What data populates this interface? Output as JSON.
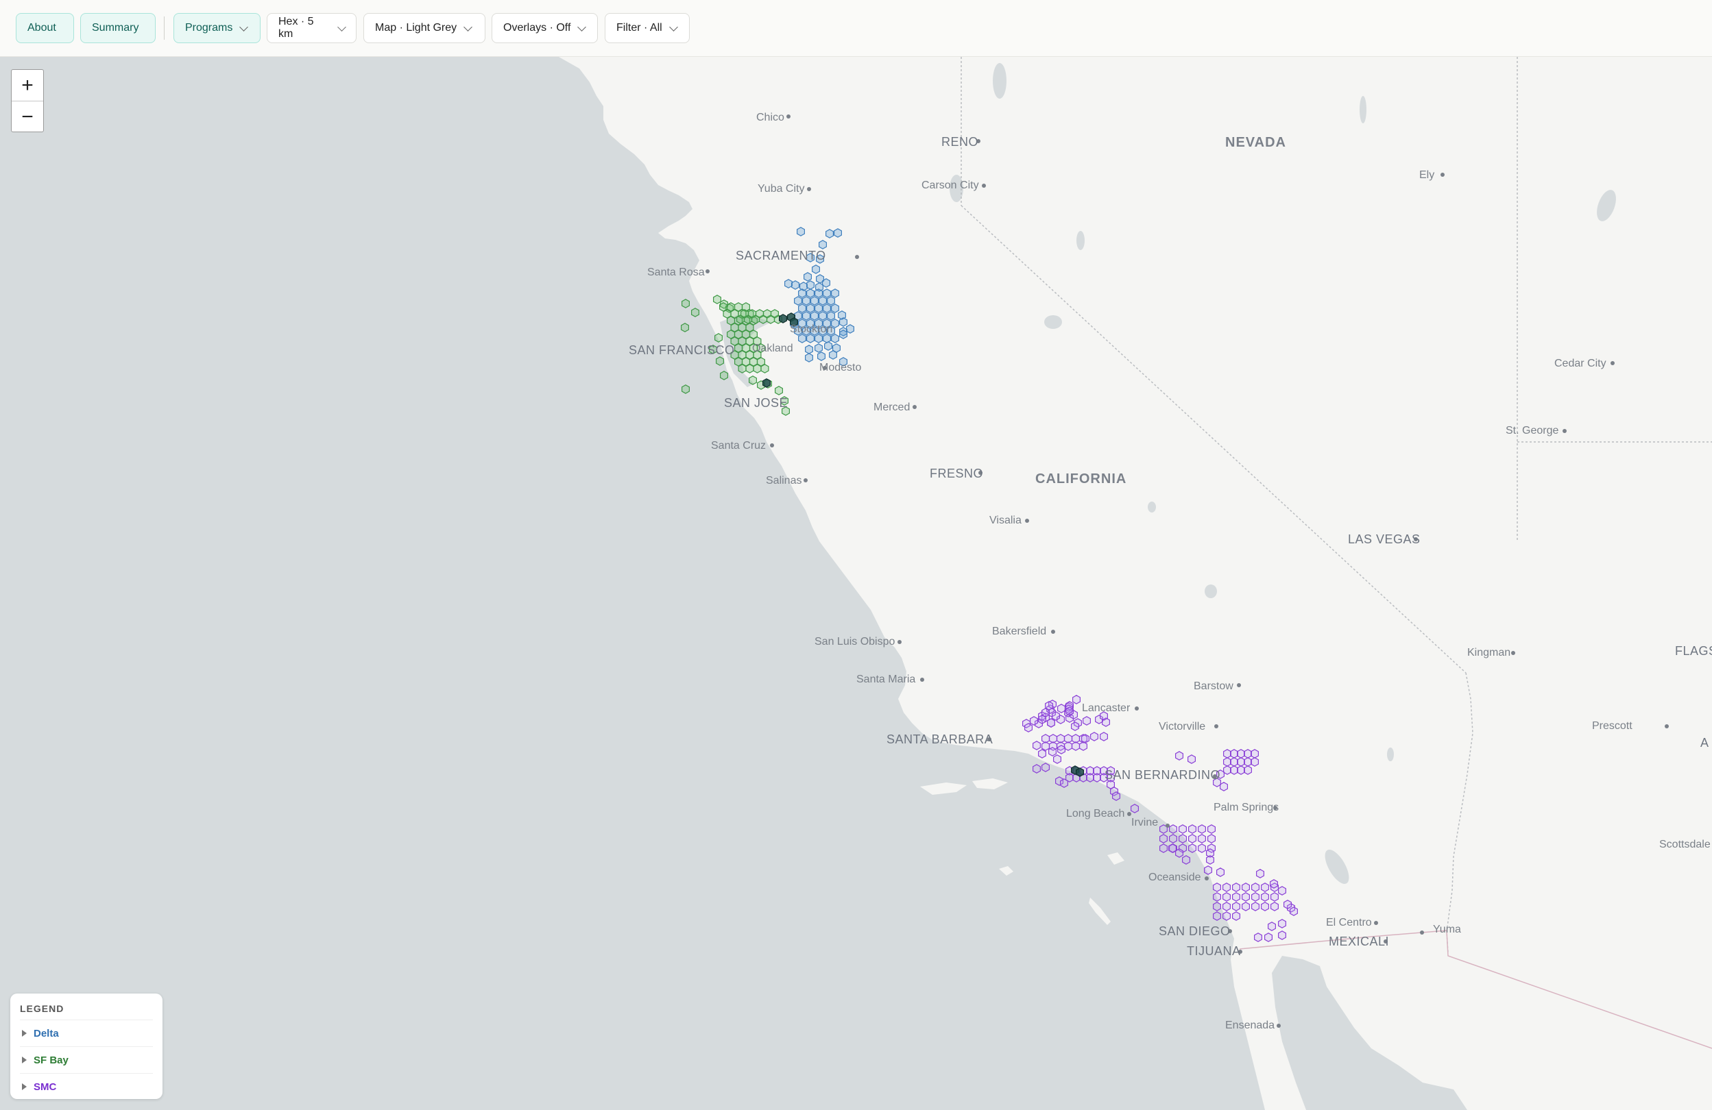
{
  "toolbar": {
    "about": "About",
    "summary": "Summary",
    "programs": "Programs",
    "hex": "Hex · 5 km",
    "map_style": "Map · Light Grey",
    "overlays": "Overlays · Off",
    "filter": "Filter · All"
  },
  "zoom": {
    "in": "+",
    "out": "−"
  },
  "legend": {
    "title": "LEGEND",
    "items": [
      {
        "label": "Delta",
        "color": "#3f7fbd"
      },
      {
        "label": "SF Bay",
        "color": "#2e8b3a"
      },
      {
        "label": "SMC",
        "color": "#8a3fd6"
      }
    ]
  },
  "labels": {
    "nevada": "NEVADA",
    "california": "CALIFORNIA",
    "reno": "RENO",
    "chico": "Chico",
    "carson_city": "Carson City",
    "yuba_city": "Yuba City",
    "sacramento": "SACRAMENTO",
    "santa_rosa": "Santa Rosa",
    "san_francisco": "SAN FRANCISCO",
    "oakland": "Oakland",
    "stockton": "Stockton",
    "modesto": "Modesto",
    "san_jose": "SAN JOSE",
    "merced": "Merced",
    "santa_cruz": "Santa Cruz",
    "salinas": "Salinas",
    "fresno": "FRESNO",
    "visalia": "Visalia",
    "las_vegas": "LAS VEGAS",
    "ely": "Ely",
    "cedar_city": "Cedar City",
    "st_george": "St. George",
    "bakersfield": "Bakersfield",
    "san_luis_obispo": "San Luis Obispo",
    "santa_maria": "Santa Maria",
    "kingman": "Kingman",
    "flagstaff": "FLAGS",
    "barstow": "Barstow",
    "lancaster": "Lancaster",
    "victorville": "Victorville",
    "prescott": "Prescott",
    "santa_barbara": "SANTA BARBARA",
    "san_bernardino": "SAN BERNARDINO",
    "long_beach": "Long Beach",
    "irvine": "Irvine",
    "palm_springs": "Palm Springs",
    "scottsdale": "Scottsdale",
    "oceanside": "Oceanside",
    "el_centro": "El Centro",
    "san_diego": "SAN DIEGO",
    "yuma": "Yuma",
    "mexicali": "MEXICALI",
    "tijuana": "TIJUANA",
    "ensenada": "Ensenada",
    "az_edge": "A"
  },
  "colors": {
    "ocean": "#d6dbdd",
    "land": "#f4f4f2",
    "delta": "#5a9bd5",
    "sfbay": "#6cc06f",
    "smc": "#a06ee8"
  }
}
